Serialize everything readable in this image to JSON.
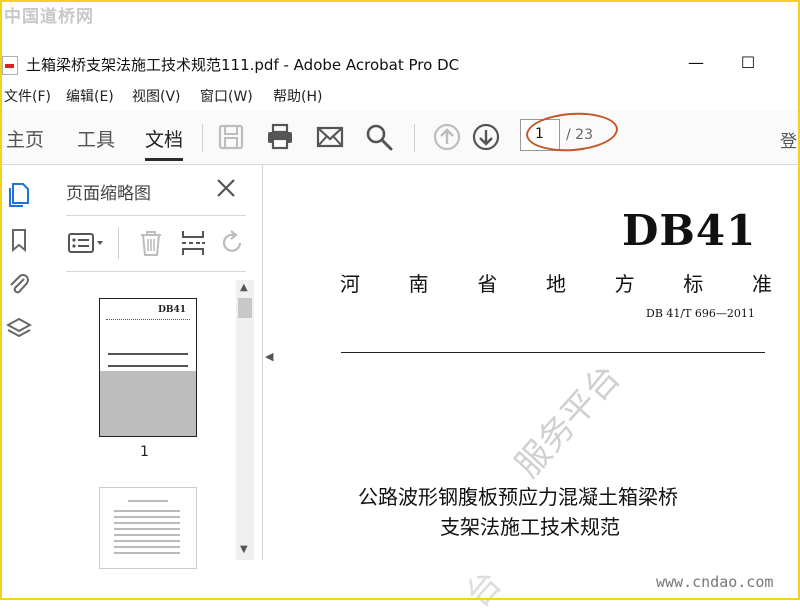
{
  "watermarks": {
    "top_left": "中国道桥网",
    "diagonal": "服务平台",
    "diagonal_lower": "台",
    "url": "www.cndao.com"
  },
  "window": {
    "title": "土箱梁桥支架法施工技术规范111.pdf - Adobe Acrobat Pro DC",
    "minimize_glyph": "—",
    "maximize_glyph": "☐"
  },
  "menu": [
    "文件(F)",
    "编辑(E)",
    "视图(V)",
    "窗口(W)",
    "帮助(H)"
  ],
  "tabs": [
    {
      "label": "主页"
    },
    {
      "label": "工具"
    },
    {
      "label": "文档",
      "active": true
    }
  ],
  "toolbar": {
    "icons": [
      "save-icon",
      "print-icon",
      "email-icon",
      "search-icon",
      "page-up-icon",
      "page-down-icon"
    ],
    "current_page": "1",
    "total_pages": "/ 23",
    "login_glyph": "登"
  },
  "annotation_color": "#c2572a",
  "left_rail": [
    "pages-icon",
    "bookmark-icon",
    "attachment-icon",
    "layers-icon"
  ],
  "thumbnails_panel": {
    "title": "页面缩略图",
    "tools": [
      "options-icon",
      "delete-icon",
      "insert-page-icon",
      "rotate-icon"
    ],
    "pages": [
      {
        "number": "1",
        "header": "DB41"
      },
      {
        "number": ""
      }
    ]
  },
  "document": {
    "code": "DB41",
    "province_chars": [
      "河",
      "南",
      "省",
      "地",
      "方",
      "标",
      "准"
    ],
    "standard_number": "DB 41/T  696—2011",
    "title_line1": "公路波形钢腹板预应力混凝土箱梁桥",
    "title_line2": "支架法施工技术规范"
  }
}
